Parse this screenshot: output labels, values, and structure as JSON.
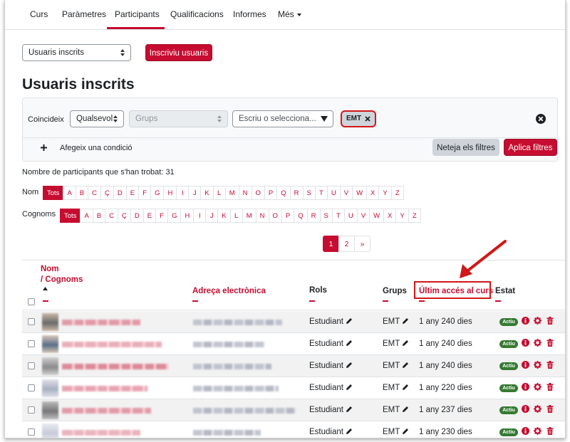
{
  "nav": {
    "items": [
      "Curs",
      "Paràmetres",
      "Participants",
      "Qualificacions",
      "Informes",
      "Més"
    ]
  },
  "enrol": {
    "select_value": "Usuaris inscrits",
    "button": "Inscriviu usuaris"
  },
  "page_title": "Usuaris inscrits",
  "filters": {
    "match_label": "Coincideix",
    "match_value": "Qualsevol",
    "type_value": "Grups",
    "search_placeholder": "Escriu o selecciona...",
    "chip": "EMT",
    "add_condition": "Afegeix una condició",
    "clear_button": "Neteja els filtres",
    "apply_button": "Aplica filtres"
  },
  "count_text": "Nombre de participants que s'han trobat: 31",
  "initials": {
    "first_label": "Nom",
    "last_label": "Cognoms",
    "all": "Tots",
    "letters": [
      "A",
      "B",
      "C",
      "Ç",
      "D",
      "E",
      "F",
      "G",
      "H",
      "I",
      "J",
      "K",
      "L",
      "M",
      "N",
      "O",
      "P",
      "Q",
      "R",
      "S",
      "T",
      "U",
      "V",
      "W",
      "X",
      "Y",
      "Z"
    ]
  },
  "pagination": [
    "1",
    "2",
    "»"
  ],
  "table": {
    "headers": {
      "name": "Nom",
      "surname": "/ Cognoms",
      "email": "Adreça electrònica",
      "roles": "Rols",
      "groups": "Grups",
      "last_access": "Últim accés al curs",
      "status": "Estat"
    },
    "rows": [
      {
        "role": "Estudiant",
        "group": "EMT",
        "last_access": "1 any 240 dies",
        "status": "Actiu"
      },
      {
        "role": "Estudiant",
        "group": "EMT",
        "last_access": "1 any 240 dies",
        "status": "Actiu"
      },
      {
        "role": "Estudiant",
        "group": "EMT",
        "last_access": "1 any 240 dies",
        "status": "Actiu"
      },
      {
        "role": "Estudiant",
        "group": "EMT",
        "last_access": "1 any 220 dies",
        "status": "Actiu"
      },
      {
        "role": "Estudiant",
        "group": "EMT",
        "last_access": "1 any 237 dies",
        "status": "Actiu"
      },
      {
        "role": "Estudiant",
        "group": "EMT",
        "last_access": "1 any 230 dies",
        "status": "Actiu"
      }
    ]
  },
  "colors": {
    "brand": "#c60c30",
    "success": "#357a32",
    "annotation": "#d01818"
  }
}
